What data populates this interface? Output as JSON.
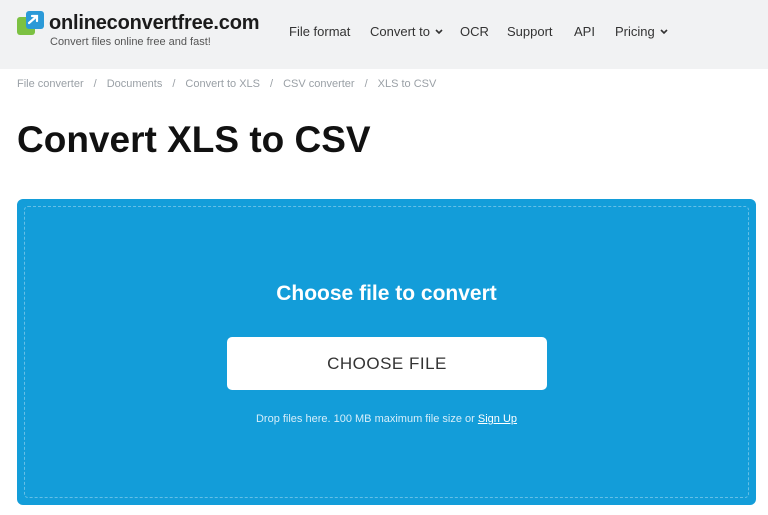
{
  "header": {
    "logo_text": "onlineconvertfree.com",
    "tagline": "Convert files online free and fast!",
    "nav": [
      {
        "label": "File format",
        "has_dropdown": false
      },
      {
        "label": "Convert to",
        "has_dropdown": true
      },
      {
        "label": "OCR",
        "has_dropdown": false
      },
      {
        "label": "Support",
        "has_dropdown": false
      },
      {
        "label": "API",
        "has_dropdown": false
      },
      {
        "label": "Pricing",
        "has_dropdown": true
      }
    ]
  },
  "breadcrumb": [
    "File converter",
    "Documents",
    "Convert to XLS",
    "CSV converter",
    "XLS to CSV"
  ],
  "breadcrumb_separator": "/",
  "main": {
    "title": "Convert XLS to CSV",
    "upload": {
      "heading": "Choose file to convert",
      "button_label": "CHOOSE FILE",
      "hint_text": "Drop files here. 100 MB maximum file size or",
      "signup_link": "Sign Up"
    }
  },
  "colors": {
    "header_bg": "#f1f2f3",
    "upload_panel": "#139dd9",
    "logo_green": "#7cc142",
    "logo_blue": "#2b9ad8"
  }
}
